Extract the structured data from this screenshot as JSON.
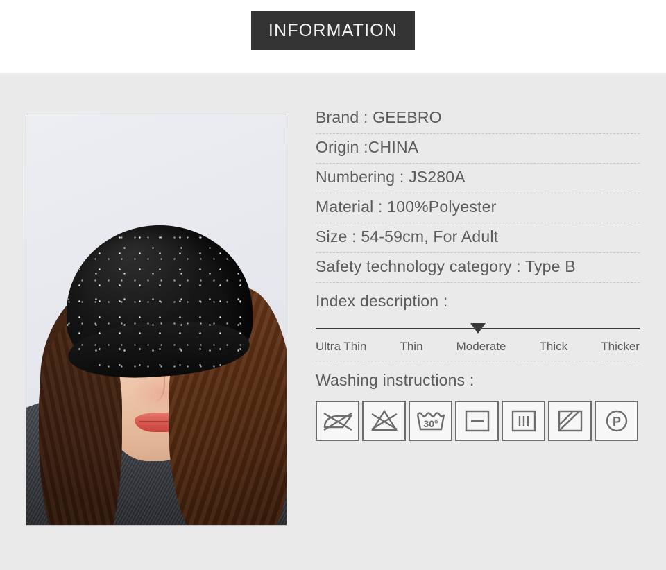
{
  "header": {
    "title": "INFORMATION",
    "banner_color": "#333333",
    "text_color": "#f2f2f2"
  },
  "panel": {
    "background_color": "#eaeaea"
  },
  "product_photo": {
    "alt_description": "Model wearing black rhinestone beanie hat",
    "frame_border_color": "#c8c8cc"
  },
  "specs": [
    {
      "text": "Brand : GEEBRO"
    },
    {
      "text": "Origin :CHINA"
    },
    {
      "text": "Numbering : JS280A"
    },
    {
      "text": "Material : 100%Polyester"
    },
    {
      "text": "Size : 54-59cm, For Adult"
    },
    {
      "text": "Safety technology category : Type B"
    }
  ],
  "index": {
    "title": "Index description :",
    "labels": [
      "Ultra Thin",
      "Thin",
      "Moderate",
      "Thick",
      "Thicker"
    ],
    "selected": "Moderate",
    "marker_position_percent": 50,
    "line_color": "#3a3a3a"
  },
  "washing": {
    "title": "Washing instructions :",
    "icons": [
      {
        "name": "do-not-wring-icon",
        "label": "Do not wring"
      },
      {
        "name": "do-not-bleach-icon",
        "label": "Do not bleach"
      },
      {
        "name": "machine-wash-30-icon",
        "label": "Machine wash at 30 degrees",
        "temperature": "30°"
      },
      {
        "name": "dry-flat-icon",
        "label": "Dry flat"
      },
      {
        "name": "drip-dry-icon",
        "label": "Drip dry"
      },
      {
        "name": "dry-in-shade-icon",
        "label": "Dry in shade"
      },
      {
        "name": "dry-clean-petroleum-icon",
        "label": "Dry clean with petroleum solvent",
        "letter": "P"
      }
    ],
    "icon_border_color": "#6d6d6d"
  }
}
